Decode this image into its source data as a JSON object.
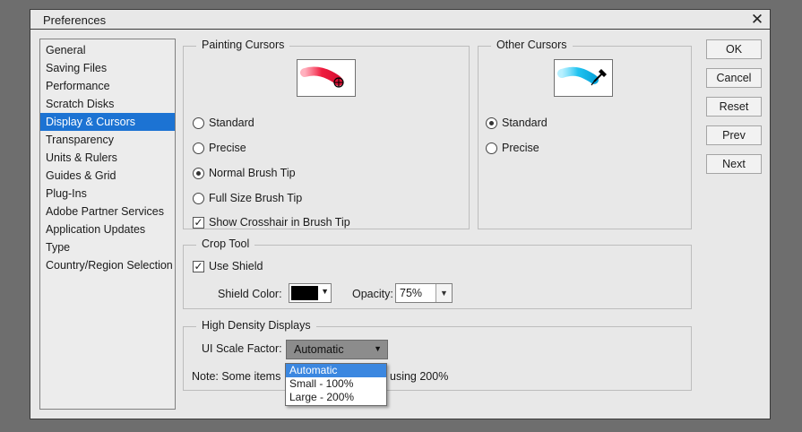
{
  "window": {
    "title": "Preferences",
    "close_glyph": "✕"
  },
  "sidebar": {
    "items": [
      {
        "label": "General"
      },
      {
        "label": "Saving Files"
      },
      {
        "label": "Performance"
      },
      {
        "label": "Scratch Disks"
      },
      {
        "label": "Display & Cursors",
        "selected": true
      },
      {
        "label": "Transparency"
      },
      {
        "label": "Units & Rulers"
      },
      {
        "label": "Guides & Grid"
      },
      {
        "label": "Plug-Ins"
      },
      {
        "label": "Adobe Partner Services"
      },
      {
        "label": "Application Updates"
      },
      {
        "label": "Type"
      },
      {
        "label": "Country/Region Selection"
      }
    ]
  },
  "painting_cursors": {
    "group_label": "Painting Cursors",
    "preview_icon": "red-brush-crosshair-icon",
    "options": [
      {
        "label": "Standard",
        "checked": false
      },
      {
        "label": "Precise",
        "checked": false
      },
      {
        "label": "Normal Brush Tip",
        "checked": true
      },
      {
        "label": "Full Size Brush Tip",
        "checked": false
      }
    ],
    "crosshair_checkbox": {
      "label": "Show Crosshair in Brush Tip",
      "checked": true
    }
  },
  "other_cursors": {
    "group_label": "Other Cursors",
    "preview_icon": "blue-brush-eyedropper-icon",
    "options": [
      {
        "label": "Standard",
        "checked": true
      },
      {
        "label": "Precise",
        "checked": false
      }
    ]
  },
  "crop_tool": {
    "group_label": "Crop Tool",
    "use_shield": {
      "label": "Use Shield",
      "checked": true
    },
    "shield_color_label": "Shield Color:",
    "shield_color": "#000000",
    "opacity_label": "Opacity:",
    "opacity_value": "75%"
  },
  "high_density": {
    "group_label": "High Density Displays",
    "scale_label": "UI Scale Factor:",
    "scale_value": "Automatic",
    "options": [
      "Automatic",
      "Small - 100%",
      "Large - 200%"
    ],
    "note_prefix": "Note: Some items",
    "note_suffix": "using 200%"
  },
  "buttons": {
    "ok": "OK",
    "cancel": "Cancel",
    "reset": "Reset",
    "prev": "Prev",
    "next": "Next"
  },
  "colors": {
    "selection": "#1c73d3",
    "dialog_bg": "#e8e8e8"
  }
}
